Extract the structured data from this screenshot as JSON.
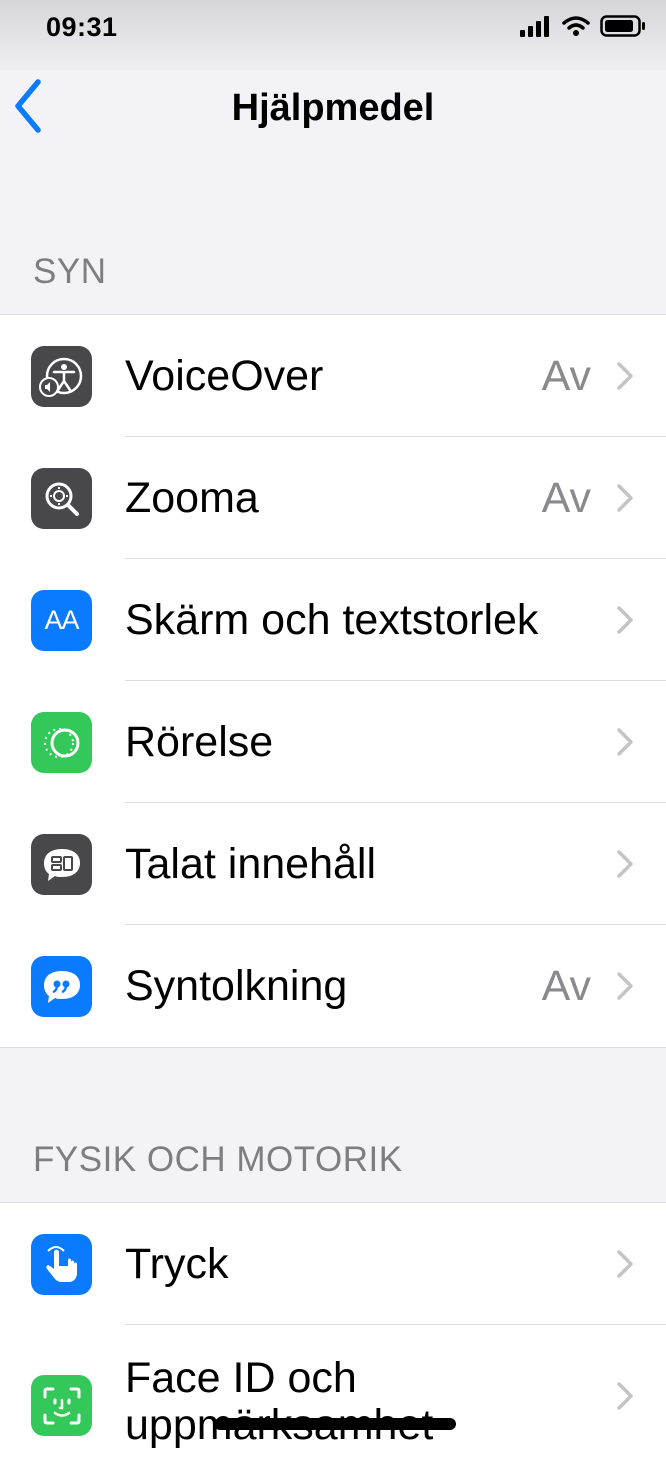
{
  "status": {
    "time": "09:31"
  },
  "nav": {
    "title": "Hjälpmedel"
  },
  "sections": [
    {
      "header": "SYN",
      "items": [
        {
          "label": "VoiceOver",
          "value": "Av",
          "icon": "voiceover-icon",
          "icon_color": "#48484a"
        },
        {
          "label": "Zooma",
          "value": "Av",
          "icon": "zoom-icon",
          "icon_color": "#48484a"
        },
        {
          "label": "Skärm och textstorlek",
          "value": "",
          "icon": "text-size-icon",
          "icon_text": "AA",
          "icon_color": "#0a7aff"
        },
        {
          "label": "Rörelse",
          "value": "",
          "icon": "motion-icon",
          "icon_color": "#34c759"
        },
        {
          "label": "Talat innehåll",
          "value": "",
          "icon": "spoken-content-icon",
          "icon_color": "#48484a"
        },
        {
          "label": "Syntolkning",
          "value": "Av",
          "icon": "audio-description-icon",
          "icon_color": "#0a7aff"
        }
      ]
    },
    {
      "header": "FYSIK OCH MOTORIK",
      "items": [
        {
          "label": "Tryck",
          "value": "",
          "icon": "touch-icon",
          "icon_color": "#0a7aff"
        },
        {
          "label": "Face ID och uppmärksamhet",
          "value": "",
          "icon": "face-id-icon",
          "icon_color": "#34c759"
        }
      ]
    }
  ]
}
